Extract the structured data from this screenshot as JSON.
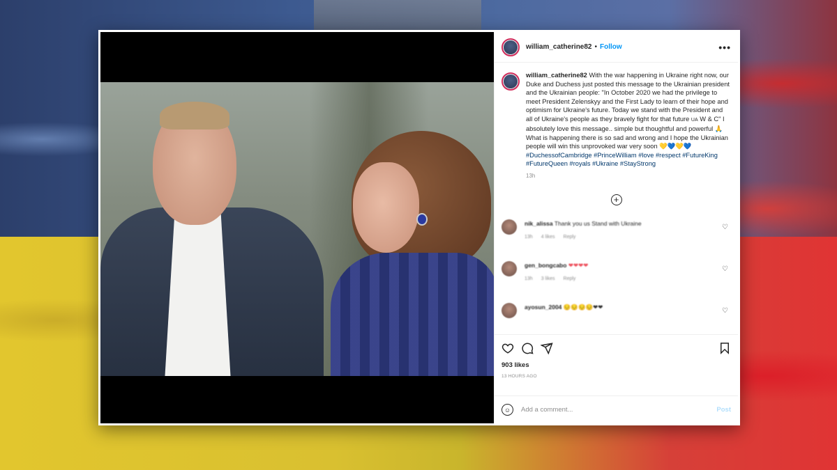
{
  "post": {
    "username": "william_catherine82",
    "follow_label": "Follow",
    "separator": "•",
    "more_label": "•••",
    "caption_username": "william_catherine82",
    "caption_text": " With the war happening in Ukraine right now, our Duke and Duchess just posted this message to the Ukrainian president and the Ukrainian people: \"In October 2020 we had the privilege to meet President Zelenskyy and the First Lady to learn of their hope and optimism for Ukraine's future. Today we stand with the President and all of Ukraine's people as they bravely fight for that future ",
    "caption_flag": "UA",
    "caption_text_2": " W & C\" I absolutely love this message.. simple but thoughtful and powerful 🙏 What is happening there is so sad and wrong and I hope the Ukrainian people will win this unprovoked war very soon 💛💙💛💙 ",
    "hashtags": "#DuchessofCambridge #PrinceWilliam #love #respect #FutureKing #FutureQueen #royals #Ukraine #StayStrong",
    "caption_time": "13h",
    "load_more_label": "+",
    "likes": "903 likes",
    "posted_time": "13 HOURS AGO"
  },
  "comments": [
    {
      "user": "nik_alissa",
      "text": "Thank you us Stand with Ukraine",
      "time": "13h",
      "likes": "4 likes",
      "reply": "Reply"
    },
    {
      "user": "gen_bongcabo",
      "text": "❤❤❤❤",
      "time": "13h",
      "likes": "3 likes",
      "reply": "Reply"
    },
    {
      "user": "ayosun_2004",
      "text": "😔😔😔😔❤❤",
      "time": "",
      "likes": "",
      "reply": ""
    }
  ],
  "add_comment": {
    "placeholder": "Add a comment...",
    "post_label": "Post",
    "emoji_label": "☺"
  },
  "colors": {
    "accent": "#0095f6",
    "post_disabled": "#b2dffc",
    "text": "#262626",
    "muted": "#8e8e8e"
  }
}
